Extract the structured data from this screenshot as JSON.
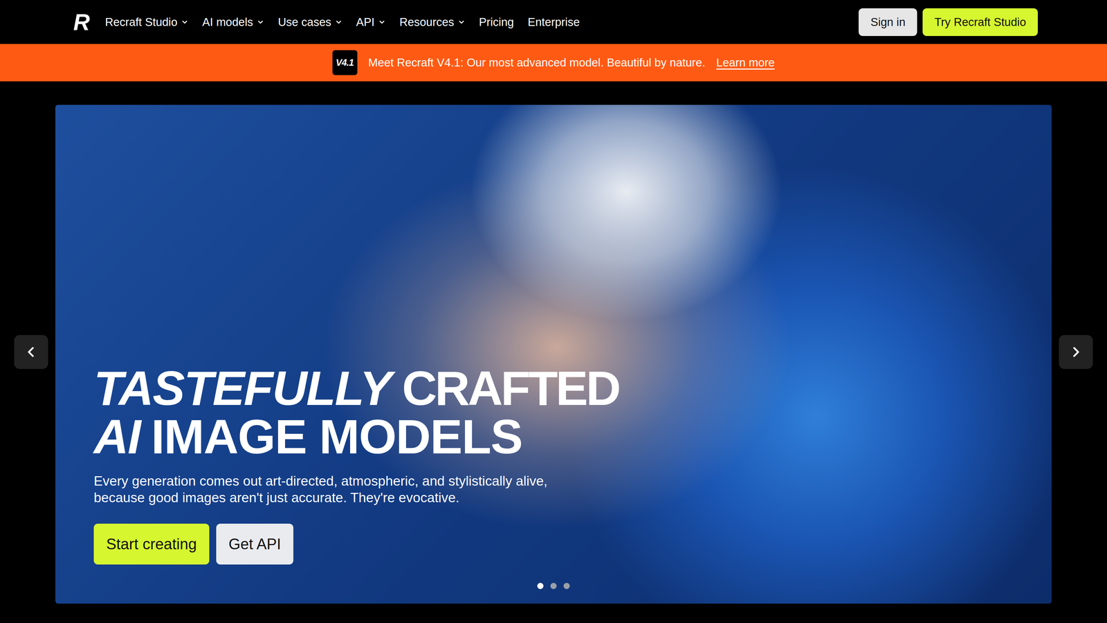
{
  "nav": {
    "logo": "R",
    "items": [
      {
        "label": "Recraft Studio",
        "dropdown": true
      },
      {
        "label": "AI models",
        "dropdown": true
      },
      {
        "label": "Use cases",
        "dropdown": true
      },
      {
        "label": "API",
        "dropdown": true
      },
      {
        "label": "Resources",
        "dropdown": true
      },
      {
        "label": "Pricing",
        "dropdown": false
      },
      {
        "label": "Enterprise",
        "dropdown": false
      }
    ],
    "sign_in": "Sign in",
    "cta": "Try Recraft Studio"
  },
  "banner": {
    "badge": "V4.1",
    "text": "Meet Recraft V4.1: Our most advanced model. Beautiful by nature.",
    "link": "Learn more"
  },
  "hero": {
    "headline": [
      [
        {
          "text": "TASTEFULLY",
          "kind": "italic"
        },
        {
          "text": "CRAFTED",
          "kind": "condensed"
        }
      ],
      [
        {
          "text": "AI",
          "kind": "italic"
        },
        {
          "text": "IMAGE MODELS",
          "kind": "plain"
        }
      ]
    ],
    "subtitle": "Every generation comes out art-directed, atmospheric, and stylistically alive, because good images aren't just accurate. They're evocative.",
    "buttons": [
      {
        "label": "Start creating",
        "kind": "primary"
      },
      {
        "label": "Get API",
        "kind": "secondary"
      }
    ],
    "slides": [
      {
        "selected": true
      },
      {
        "selected": false
      },
      {
        "selected": false
      }
    ]
  }
}
